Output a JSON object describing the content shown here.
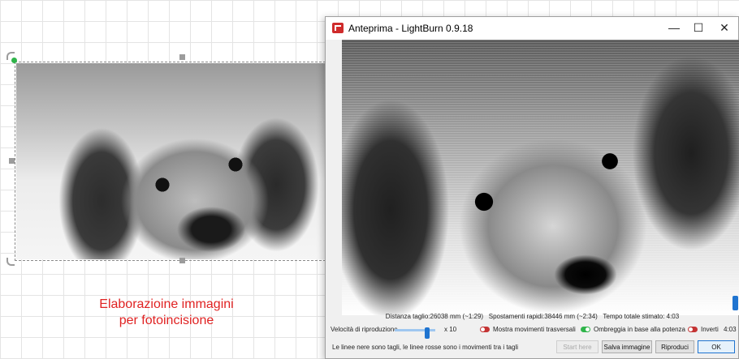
{
  "canvas": {
    "caption_line1": "Elaborazioine immagini",
    "caption_line2": "per fotoincisione"
  },
  "preview_window": {
    "title": "Anteprima - LightBurn 0.9.18",
    "controls": {
      "minimize": "—",
      "maximize": "☐",
      "close": "✕"
    },
    "status": {
      "cut_distance": "Distanza taglio:26038 mm (~1:29)",
      "rapid_moves": "Spostamenti rapidi:38446 mm (~2:34)",
      "total_time": "Tempo totale stimato: 4:03"
    },
    "playback": {
      "speed_label": "Velocità di riproduzione",
      "speed_value": "x 10"
    },
    "toggles": {
      "show_traverse": {
        "label": "Mostra movimenti trasversali",
        "state": "off"
      },
      "shade_power": {
        "label": "Ombreggia in base alla potenza",
        "state": "on"
      },
      "invert": {
        "label": "Inverti",
        "state": "off"
      }
    },
    "elapsed": "4:03",
    "hint": "Le linee nere sono tagli, le linee rosse sono i movimenti tra i tagli",
    "buttons": {
      "start_here": "Start here",
      "save_image": "Salva immagine",
      "play": "Riproduci",
      "ok": "OK"
    },
    "colors": {
      "accent": "#1f74d0",
      "toggle_on": "#2fb44a",
      "toggle_off": "#c43434",
      "caption": "#e02222"
    }
  }
}
